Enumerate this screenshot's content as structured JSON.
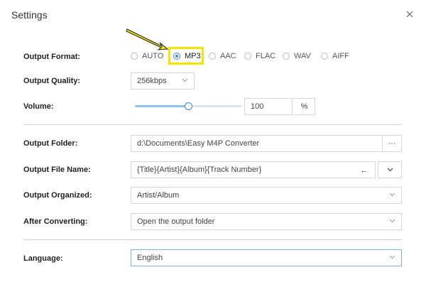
{
  "window": {
    "title": "Settings"
  },
  "output_format": {
    "label": "Output Format:",
    "options": [
      "AUTO",
      "MP3",
      "AAC",
      "FLAC",
      "WAV",
      "AIFF"
    ],
    "selected": "MP3"
  },
  "output_quality": {
    "label": "Output Quality:",
    "value": "256kbps"
  },
  "volume": {
    "label": "Volume:",
    "value": "100",
    "unit": "%",
    "level_fraction": 0.5
  },
  "output_folder": {
    "label": "Output Folder:",
    "value": "d:\\Documents\\Easy M4P Converter",
    "browse_label": "···"
  },
  "output_file_name": {
    "label": "Output File Name:",
    "value": "{Title}{Artist}{Album}{Track Number}",
    "back_icon": "←"
  },
  "output_organized": {
    "label": "Output Organized:",
    "value": "Artist/Album"
  },
  "after_converting": {
    "label": "After Converting:",
    "value": "Open the output folder"
  },
  "language": {
    "label": "Language:",
    "value": "English"
  },
  "colors": {
    "accent": "#3c86e0",
    "highlight": "#f2e600"
  }
}
